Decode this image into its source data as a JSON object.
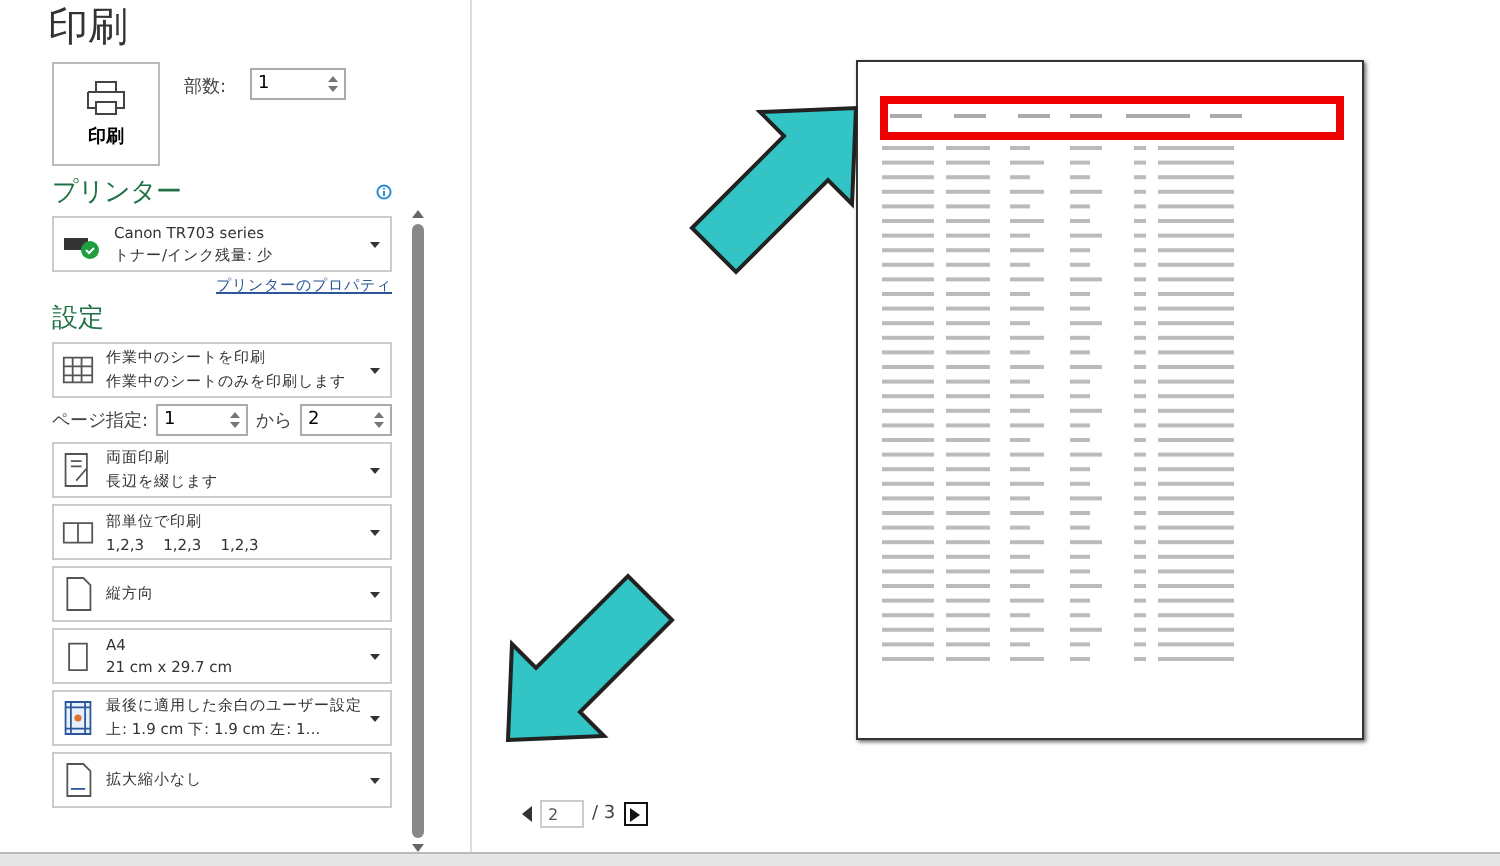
{
  "title": "印刷",
  "print_button": {
    "label": "印刷"
  },
  "copies": {
    "label": "部数:",
    "value": "1"
  },
  "printer": {
    "heading": "プリンター",
    "name": "Canon TR703 series",
    "status": "トナー/インク残量: 少",
    "properties_link": "プリンターのプロパティ"
  },
  "settings": {
    "heading": "設定",
    "items": [
      {
        "kind": "grid",
        "line1": "作業中のシートを印刷",
        "line2": "作業中のシートのみを印刷します"
      },
      {
        "kind": "range",
        "label": "ページ指定:",
        "from": "1",
        "to_label": "から",
        "to": "2"
      },
      {
        "kind": "duplex",
        "line1": "両面印刷",
        "line2": "長辺を綴じます"
      },
      {
        "kind": "collate",
        "line1": "部単位で印刷",
        "line2": "1,2,3    1,2,3    1,2,3"
      },
      {
        "kind": "portrait",
        "line1": "縦方向"
      },
      {
        "kind": "paper",
        "line1": "A4",
        "line2": "21 cm x 29.7 cm"
      },
      {
        "kind": "margins",
        "line1": "最後に適用した余白のユーザー設定",
        "line2": "上: 1.9 cm 下: 1.9 cm 左: 1…"
      },
      {
        "kind": "scale",
        "line1": "拡大縮小なし"
      }
    ]
  },
  "pager": {
    "page": "2",
    "total": "/ 3"
  }
}
